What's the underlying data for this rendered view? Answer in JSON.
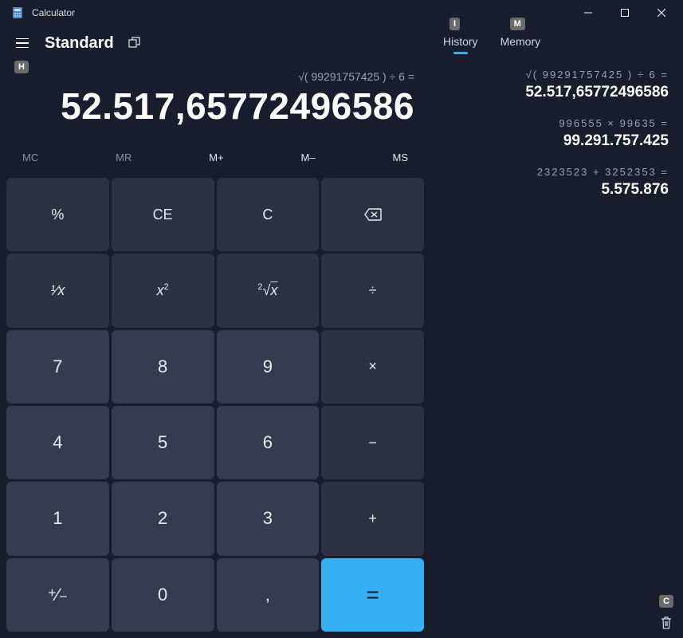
{
  "window": {
    "title": "Calculator",
    "hints": {
      "history": "I",
      "memory": "M",
      "header": "H",
      "clear": "C"
    }
  },
  "header": {
    "mode": "Standard"
  },
  "display": {
    "expression": "√( 99291757425 ) ÷ 6 =",
    "result": "52.517,65772496586"
  },
  "memory_buttons": {
    "mc": "MC",
    "mr": "MR",
    "mplus": "M+",
    "mminus": "M–",
    "ms": "MS"
  },
  "keys": {
    "percent": "%",
    "ce": "CE",
    "c": "C",
    "recip": "¹⁄ₓ",
    "square": "x²",
    "sqrt": "²√x",
    "divide": "÷",
    "multiply": "×",
    "minus": "−",
    "plus": "+",
    "equals": "=",
    "sign": "⁺/₋",
    "decimal": ",",
    "n0": "0",
    "n1": "1",
    "n2": "2",
    "n3": "3",
    "n4": "4",
    "n5": "5",
    "n6": "6",
    "n7": "7",
    "n8": "8",
    "n9": "9"
  },
  "tabs": {
    "history": "History",
    "memory": "Memory"
  },
  "history": [
    {
      "expression": "√( 99291757425 )   ÷   6 =",
      "result": "52.517,65772496586"
    },
    {
      "expression": "996555   ×   99635 =",
      "result": "99.291.757.425"
    },
    {
      "expression": "2323523   +   3252353 =",
      "result": "5.575.876"
    }
  ]
}
